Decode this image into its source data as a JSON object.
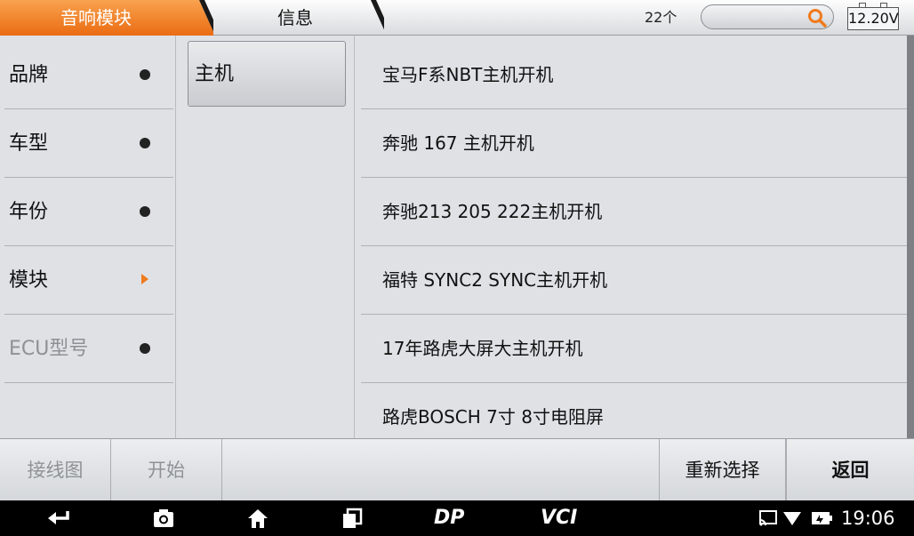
{
  "header": {
    "active_tab": "音响模块",
    "tab_info": "信息",
    "result_count": "22个",
    "voltage": "12.20V"
  },
  "left_menu": [
    {
      "label": "品牌",
      "marker": "dot",
      "enabled": true
    },
    {
      "label": "车型",
      "marker": "dot",
      "enabled": true
    },
    {
      "label": "年份",
      "marker": "dot",
      "enabled": true
    },
    {
      "label": "模块",
      "marker": "arrow",
      "enabled": true
    },
    {
      "label": "ECU型号",
      "marker": "dot",
      "enabled": false
    }
  ],
  "middle_menu": [
    {
      "label": "主机"
    }
  ],
  "options": [
    {
      "label": "宝马F系NBT主机开机"
    },
    {
      "label": "奔驰 167 主机开机"
    },
    {
      "label": "奔驰213 205 222主机开机"
    },
    {
      "label": "福特 SYNC2 SYNC主机开机"
    },
    {
      "label": "17年路虎大屏大主机开机"
    },
    {
      "label": "路虎BOSCH 7寸 8寸电阻屏"
    }
  ],
  "footer": {
    "wiring_diagram": "接线图",
    "start": "开始",
    "reselect": "重新选择",
    "back": "返回"
  },
  "system_bar": {
    "time": "19:06",
    "dp_label": "DP",
    "vci_label": "VCI"
  },
  "colors": {
    "accent_orange": "#f07a1c",
    "background": "#dfe1e5"
  },
  "icons": [
    "search-icon",
    "back-icon",
    "camera-icon",
    "home-icon",
    "recents-icon",
    "cast-icon",
    "wifi-icon",
    "battery-icon"
  ]
}
